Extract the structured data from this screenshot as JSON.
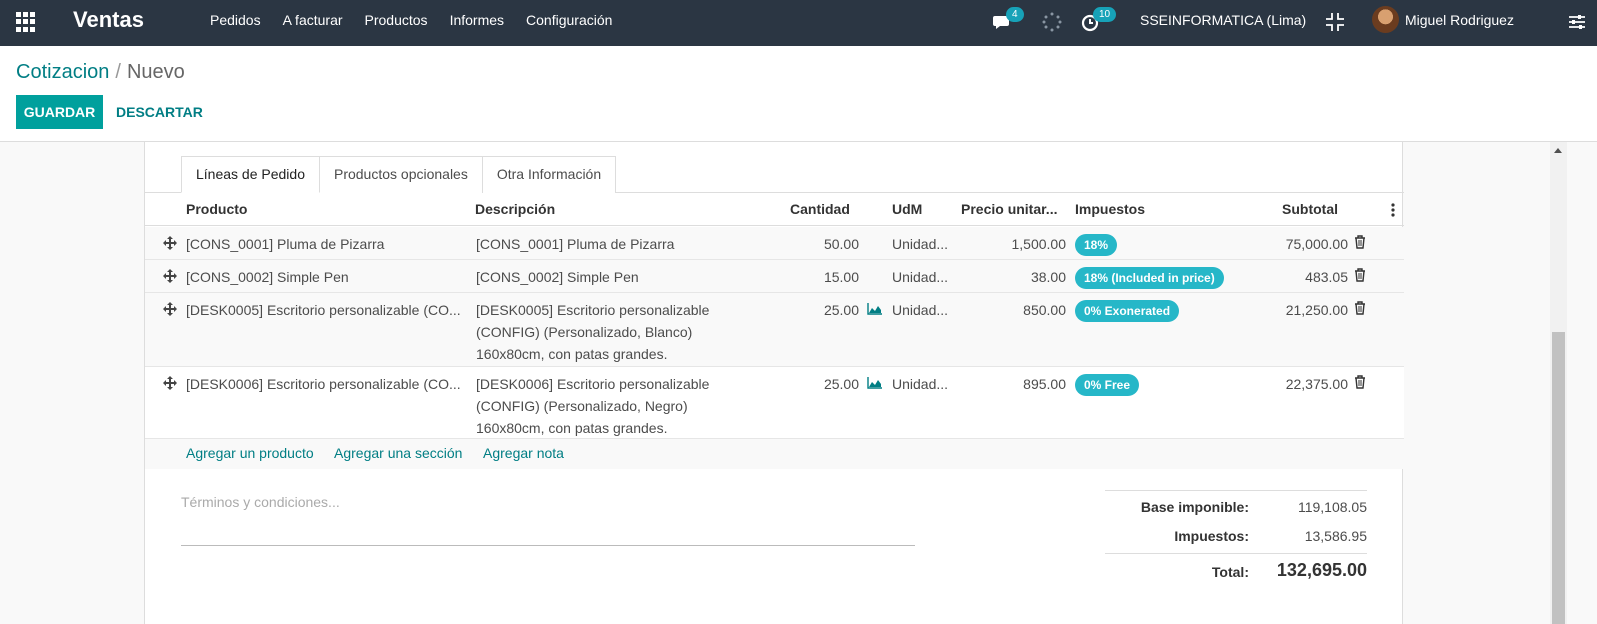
{
  "navbar": {
    "brand": "Ventas",
    "menu": [
      "Pedidos",
      "A facturar",
      "Productos",
      "Informes",
      "Configuración"
    ],
    "messages_count": "4",
    "activities_count": "10",
    "company": "SSEINFORMATICA (Lima)",
    "user": "Miguel Rodriguez"
  },
  "breadcrumb": {
    "parent": "Cotizacion",
    "separator": "/",
    "current": "Nuevo"
  },
  "buttons": {
    "save": "GUARDAR",
    "discard": "DESCARTAR"
  },
  "tabs": [
    "Líneas de Pedido",
    "Productos opcionales",
    "Otra Información"
  ],
  "table": {
    "headers": {
      "product": "Producto",
      "description": "Descripción",
      "quantity": "Cantidad",
      "uom": "UdM",
      "price": "Precio unitar...",
      "taxes": "Impuestos",
      "subtotal": "Subtotal"
    },
    "rows": [
      {
        "product": "[CONS_0001] Pluma de Pizarra",
        "description": "[CONS_0001] Pluma de Pizarra",
        "quantity": "50.00",
        "uom": "Unidad...",
        "price": "1,500.00",
        "tax": "18%",
        "subtotal": "75,000.00"
      },
      {
        "product": "[CONS_0002] Simple Pen",
        "description": "[CONS_0002] Simple Pen",
        "quantity": "15.00",
        "uom": "Unidad...",
        "price": "38.00",
        "tax": "18% (Included in price)",
        "subtotal": "483.05"
      },
      {
        "product": "[DESK0005] Escritorio personalizable (CO...",
        "description_lines": [
          "[DESK0005] Escritorio personalizable",
          "(CONFIG) (Personalizado, Blanco)",
          "160x80cm, con patas grandes."
        ],
        "quantity": "25.00",
        "uom": "Unidad...",
        "price": "850.00",
        "tax": "0% Exonerated",
        "subtotal": "21,250.00"
      },
      {
        "product": "[DESK0006] Escritorio personalizable (CO...",
        "description_lines": [
          "[DESK0006] Escritorio personalizable",
          "(CONFIG) (Personalizado, Negro)",
          "160x80cm, con patas grandes."
        ],
        "quantity": "25.00",
        "uom": "Unidad...",
        "price": "895.00",
        "tax": "0% Free",
        "subtotal": "22,375.00"
      }
    ]
  },
  "add_links": {
    "product": "Agregar un producto",
    "section": "Agregar una sección",
    "note": "Agregar nota"
  },
  "terms_placeholder": "Términos y condiciones...",
  "totals": {
    "base_label": "Base imponible:",
    "base_value": "119,108.05",
    "tax_label": "Impuestos:",
    "tax_value": "13,586.95",
    "total_label": "Total:",
    "total_value": "132,695.00"
  },
  "colors": {
    "navbar": "#2b3643",
    "accent": "#00a09d",
    "link": "#017e84",
    "badge": "#26b7c8"
  }
}
